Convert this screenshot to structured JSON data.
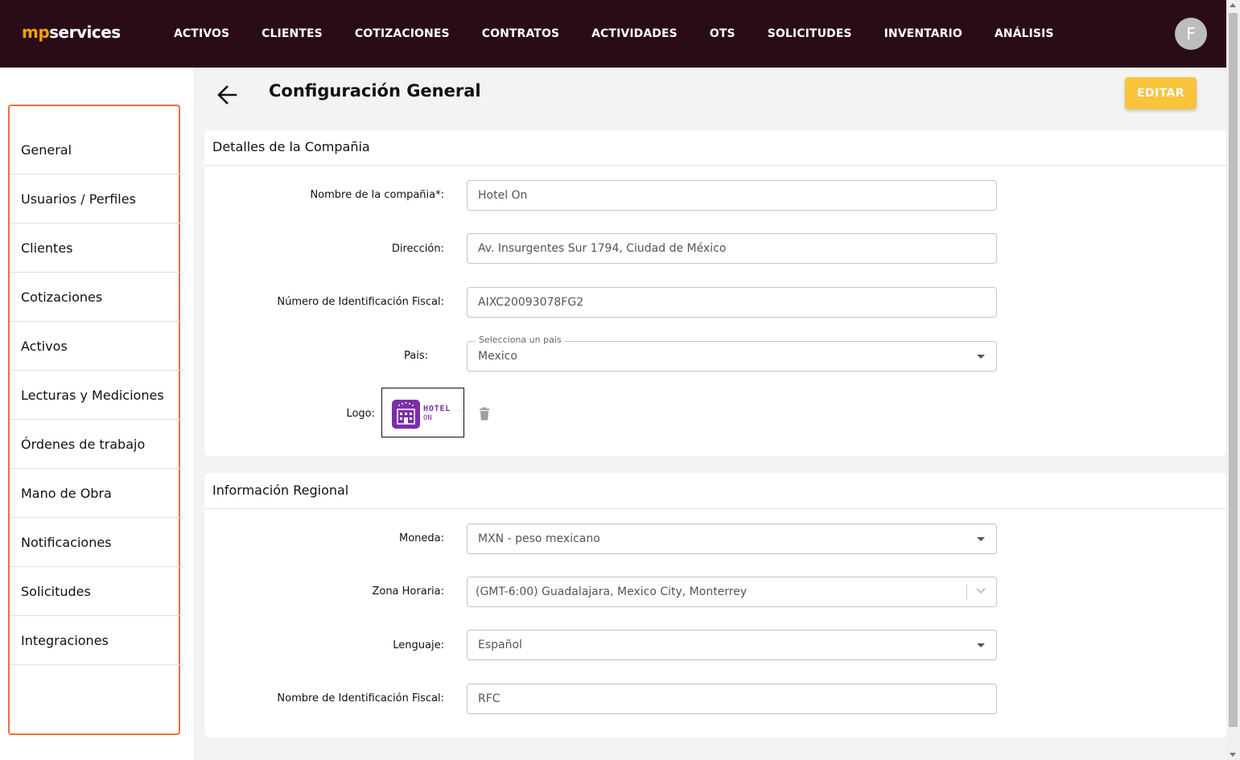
{
  "brand": {
    "part1": "mp",
    "part2": "services"
  },
  "nav": {
    "items": [
      "ACTIVOS",
      "CLIENTES",
      "COTIZACIONES",
      "CONTRATOS",
      "ACTIVIDADES",
      "OTS",
      "SOLICITUDES",
      "INVENTARIO",
      "ANÁLISIS"
    ]
  },
  "user": {
    "initial": "F"
  },
  "sidebar": {
    "items": [
      {
        "label": "General"
      },
      {
        "label": "Usuarios / Perfiles"
      },
      {
        "label": "Clientes"
      },
      {
        "label": "Cotizaciones"
      },
      {
        "label": "Activos"
      },
      {
        "label": "Lecturas y Mediciones"
      },
      {
        "label": "Órdenes de trabajo"
      },
      {
        "label": "Mano de Obra"
      },
      {
        "label": "Notificaciones"
      },
      {
        "label": "Solicitudes"
      },
      {
        "label": "Integraciones"
      }
    ]
  },
  "header": {
    "title": "Configuración General",
    "edit_label": "EDITAR"
  },
  "company": {
    "title": "Detalles de la Compañia",
    "name_label": "Nombre de la compañia*:",
    "name_value": "Hotel On",
    "address_label": "Dirección:",
    "address_value": "Av. Insurgentes Sur 1794, Ciudad de México",
    "tax_id_label": "Número de Identificación Fiscal:",
    "tax_id_value": "AIXC20093078FG2",
    "country_label": "Pais:",
    "country_legend": "Selecciona un pais",
    "country_value": "Mexico",
    "logo_label": "Logo:",
    "logo_text_top": "HOTEL",
    "logo_text_bottom": "ON"
  },
  "regional": {
    "title": "Información Regional",
    "currency_label": "Moneda:",
    "currency_value": "MXN - peso mexicano",
    "timezone_label": "Zona Horaria:",
    "timezone_value": "(GMT-6:00) Guadalajara, Mexico City, Monterrey",
    "language_label": "Lenguaje:",
    "language_value": "Español",
    "tax_name_label": "Nombre de Identificación Fiscal:",
    "tax_name_value": "RFC"
  },
  "colors": {
    "topbar": "#2a0c17",
    "brand_accent": "#f5a000",
    "sidebar_border": "#f26e3a",
    "edit_button": "#f9c33c",
    "logo_purple": "#7b2fa6"
  },
  "icons": {
    "back": "arrow-left-icon",
    "delete": "trash-icon",
    "dropdown": "caret-down-icon",
    "timezone_dropdown": "chevron-down-icon"
  }
}
